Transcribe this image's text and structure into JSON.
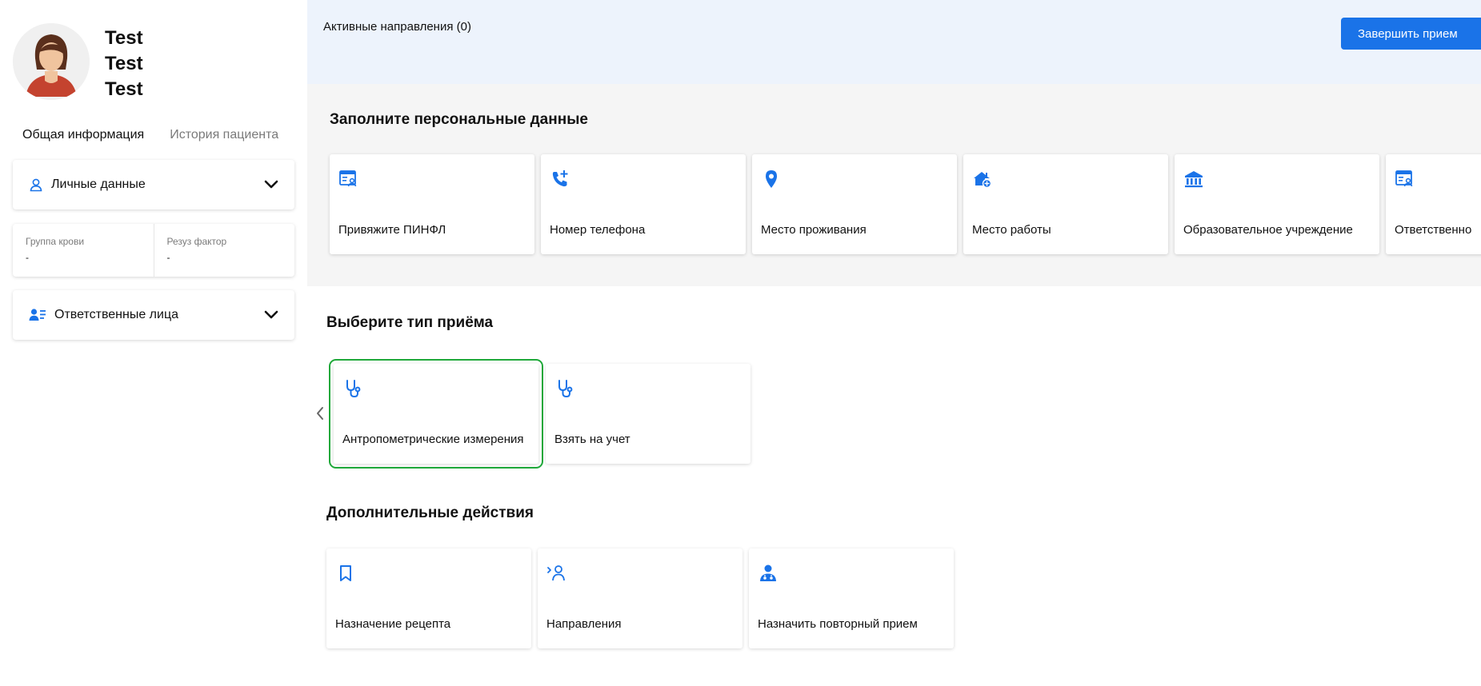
{
  "patient": {
    "name_lines": [
      "Test",
      "Test",
      "Test"
    ]
  },
  "tabs": {
    "general": "Общая информация",
    "history": "История пациента"
  },
  "sections": {
    "personal_data_label": "Личные данные",
    "responsible_label": "Ответственные лица"
  },
  "blood": {
    "group_label": "Группа крови",
    "group_value": "-",
    "rh_label": "Резуз фактор",
    "rh_value": "-"
  },
  "topbar": {
    "title": "Активные направления (0)",
    "finish_button": "Завершить прием"
  },
  "personal_fill": {
    "title": "Заполните персональные данные",
    "items": [
      {
        "label": "Привяжите ПИНФЛ",
        "icon": "id-card-icon"
      },
      {
        "label": "Номер телефона",
        "icon": "phone-add-icon"
      },
      {
        "label": "Место проживания",
        "icon": "location-pin-icon"
      },
      {
        "label": "Место работы",
        "icon": "work-place-icon"
      },
      {
        "label": "Образовательное учреждение",
        "icon": "institution-icon"
      },
      {
        "label": "Ответственно",
        "icon": "id-card-icon"
      }
    ]
  },
  "visit_type": {
    "title": "Выберите тип приёма",
    "items": [
      {
        "label": "Антропометрические измерения",
        "icon": "stethoscope-icon",
        "selected": true
      },
      {
        "label": "Взять на учет",
        "icon": "stethoscope-icon",
        "selected": false
      }
    ]
  },
  "extra_actions": {
    "title": "Дополнительные действия",
    "items": [
      {
        "label": "Назначение рецепта",
        "icon": "bookmark-icon"
      },
      {
        "label": "Направления",
        "icon": "referral-icon"
      },
      {
        "label": "Назначить повторный прием",
        "icon": "doctor-icon"
      }
    ]
  },
  "colors": {
    "accent": "#1a73e8",
    "selected_outline": "#1fa83a",
    "topbar_bg": "#edf3fc"
  }
}
